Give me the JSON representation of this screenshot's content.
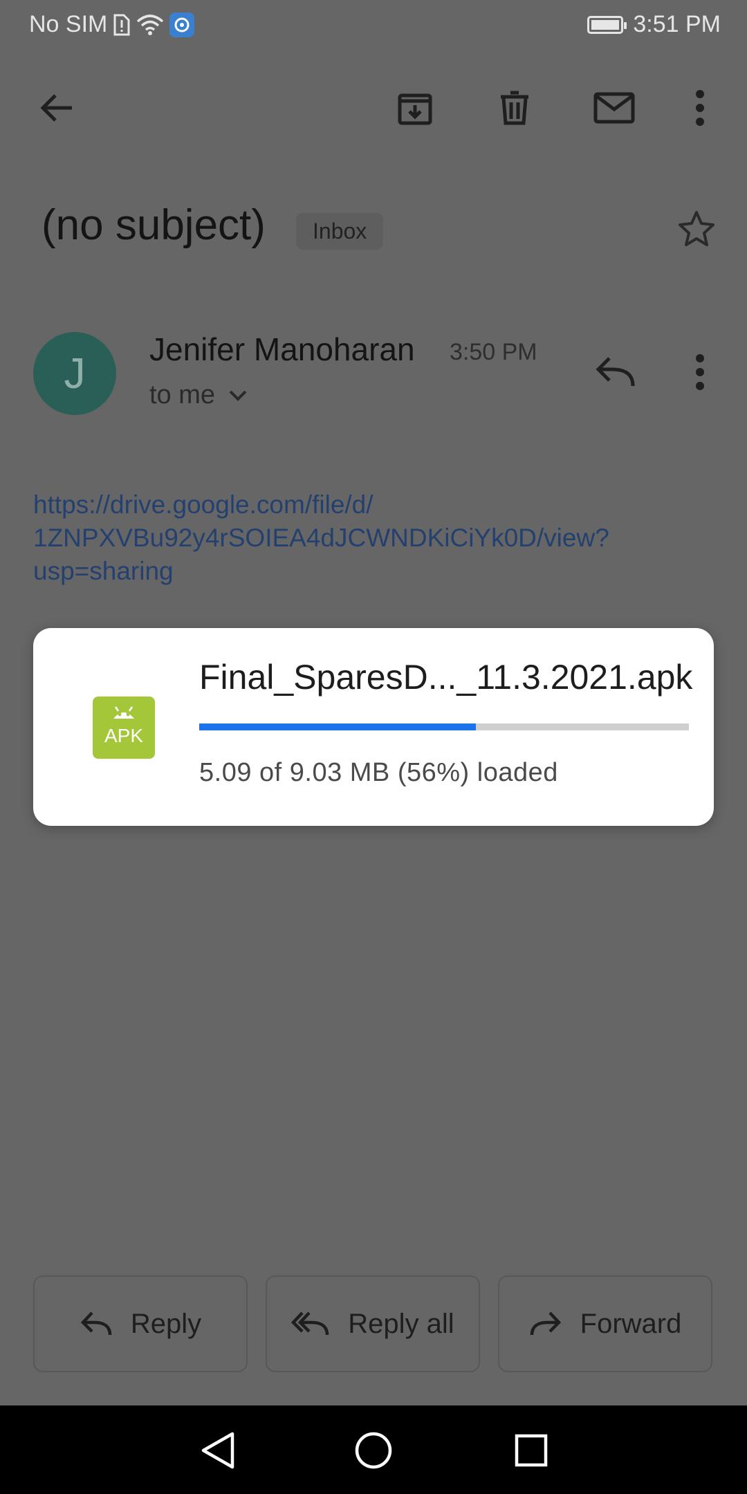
{
  "status_bar": {
    "carrier": "No SIM",
    "time": "3:51 PM"
  },
  "toolbar": {
    "back_icon": "arrow-back-icon",
    "archive_icon": "archive-icon",
    "delete_icon": "delete-icon",
    "mark_unread_icon": "mail-icon",
    "more_icon": "more-vert-icon"
  },
  "email": {
    "subject": "(no subject)",
    "label": "Inbox",
    "sender_initial": "J",
    "sender_name": "Jenifer Manoharan",
    "time": "3:50 PM",
    "recipient": "to me",
    "link_line1": "https://drive.google.com/file/d/",
    "link_line2": "1ZNPXVBu92y4rSOIEA4dJCWNDKiCiYk0D/view?",
    "link_line3": "usp=sharing"
  },
  "download": {
    "file_icon_label": "APK",
    "file_name": "Final_SparesD..._11.3.2021.apk",
    "progress_fraction": 0.565,
    "progress_text": "5.09 of 9.03 MB (56%) loaded"
  },
  "actions": {
    "reply": "Reply",
    "reply_all": "Reply all",
    "forward": "Forward"
  },
  "colors": {
    "scrim": "#666666",
    "progress": "#1a73e8",
    "apk": "#a4c639",
    "avatar": "#2a5f57",
    "link": "#24406f"
  }
}
